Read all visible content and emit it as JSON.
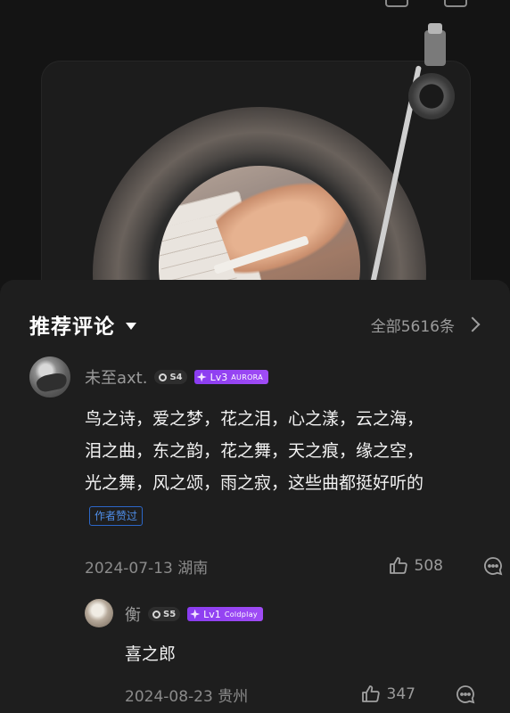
{
  "colors": {
    "background": "#141414",
    "sheet": "#1e1e1e",
    "level_badge": "#8a3cf0",
    "liked_tag": "#4f8ee8"
  },
  "section": {
    "title": "推荐评论",
    "view_all": "全部5616条"
  },
  "comments": [
    {
      "username": "未至axt.",
      "badge_s": "S4",
      "level": "Lv3",
      "level_tag": "AURORA",
      "lines": [
        "鸟之诗，爱之梦，花之泪，心之漾，云之海，",
        "泪之曲，东之韵，花之舞，天之痕，缘之空，",
        "光之舞，风之颂，雨之寂，这些曲都挺好听的"
      ],
      "tag": "作者赞过",
      "date_location": "2024-07-13 湖南",
      "likes": "508"
    },
    {
      "username": "衡",
      "badge_s": "S5",
      "level": "Lv1",
      "level_tag": "Coldplay",
      "text": "喜之郎",
      "date_location": "2024-08-23 贵州",
      "likes": "347"
    }
  ]
}
